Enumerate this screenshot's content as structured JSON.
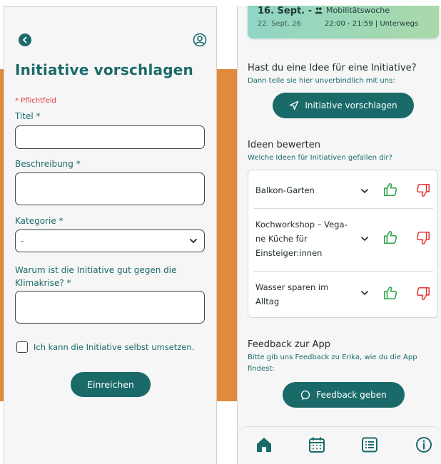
{
  "left": {
    "title": "Initiative vorschlagen",
    "required_note": "* Pflichtfeld",
    "fields": {
      "titel_label": "Titel *",
      "beschreibung_label": "Beschreibung *",
      "kategorie_label": "Kategorie *",
      "kategorie_value": "-",
      "warum_label_line1": "Warum ist die Initiative gut gegen die",
      "warum_label_line2": "Klimakrise? *"
    },
    "checkbox_label": "Ich kann die Initiative selbst umsetzen.",
    "submit_label": "Einreichen"
  },
  "right": {
    "event": {
      "date_start": "16. Sept. -",
      "date_end": "22. Sept. 26",
      "title": "Mobilitätswoche",
      "time": "22:00 - 21:59 | Unterwegs"
    },
    "idea_section": {
      "title": "Hast du eine Idee für eine Initiative?",
      "subtitle": "Dann teile sie hier unverbindlich mit uns:",
      "button": "Initiative vorschlagen"
    },
    "rate_section": {
      "title": "Ideen bewerten",
      "subtitle": "Welche Ideen für Initiativen gefallen dir?"
    },
    "ideas": [
      {
        "lines": [
          "Balkon-Garten"
        ]
      },
      {
        "lines": [
          "Kochworkshop – Vega-",
          "ne Küche für",
          "Einsteiger:innen"
        ]
      },
      {
        "lines": [
          "Wasser sparen im",
          "Alltag"
        ]
      }
    ],
    "feedback_section": {
      "title": "Feedback zur App",
      "subtitle": "Bitte gib uns Feedback zu Erika, wie du die App findest:",
      "button": "Feedback geben"
    },
    "nav": [
      "home-icon",
      "calendar-icon",
      "list-icon",
      "info-icon"
    ]
  },
  "colors": {
    "accent": "#1b6a6a",
    "required": "#e23a3a",
    "like": "#2aa84a",
    "dislike": "#e23a3a",
    "orange": "#e28a3c"
  }
}
